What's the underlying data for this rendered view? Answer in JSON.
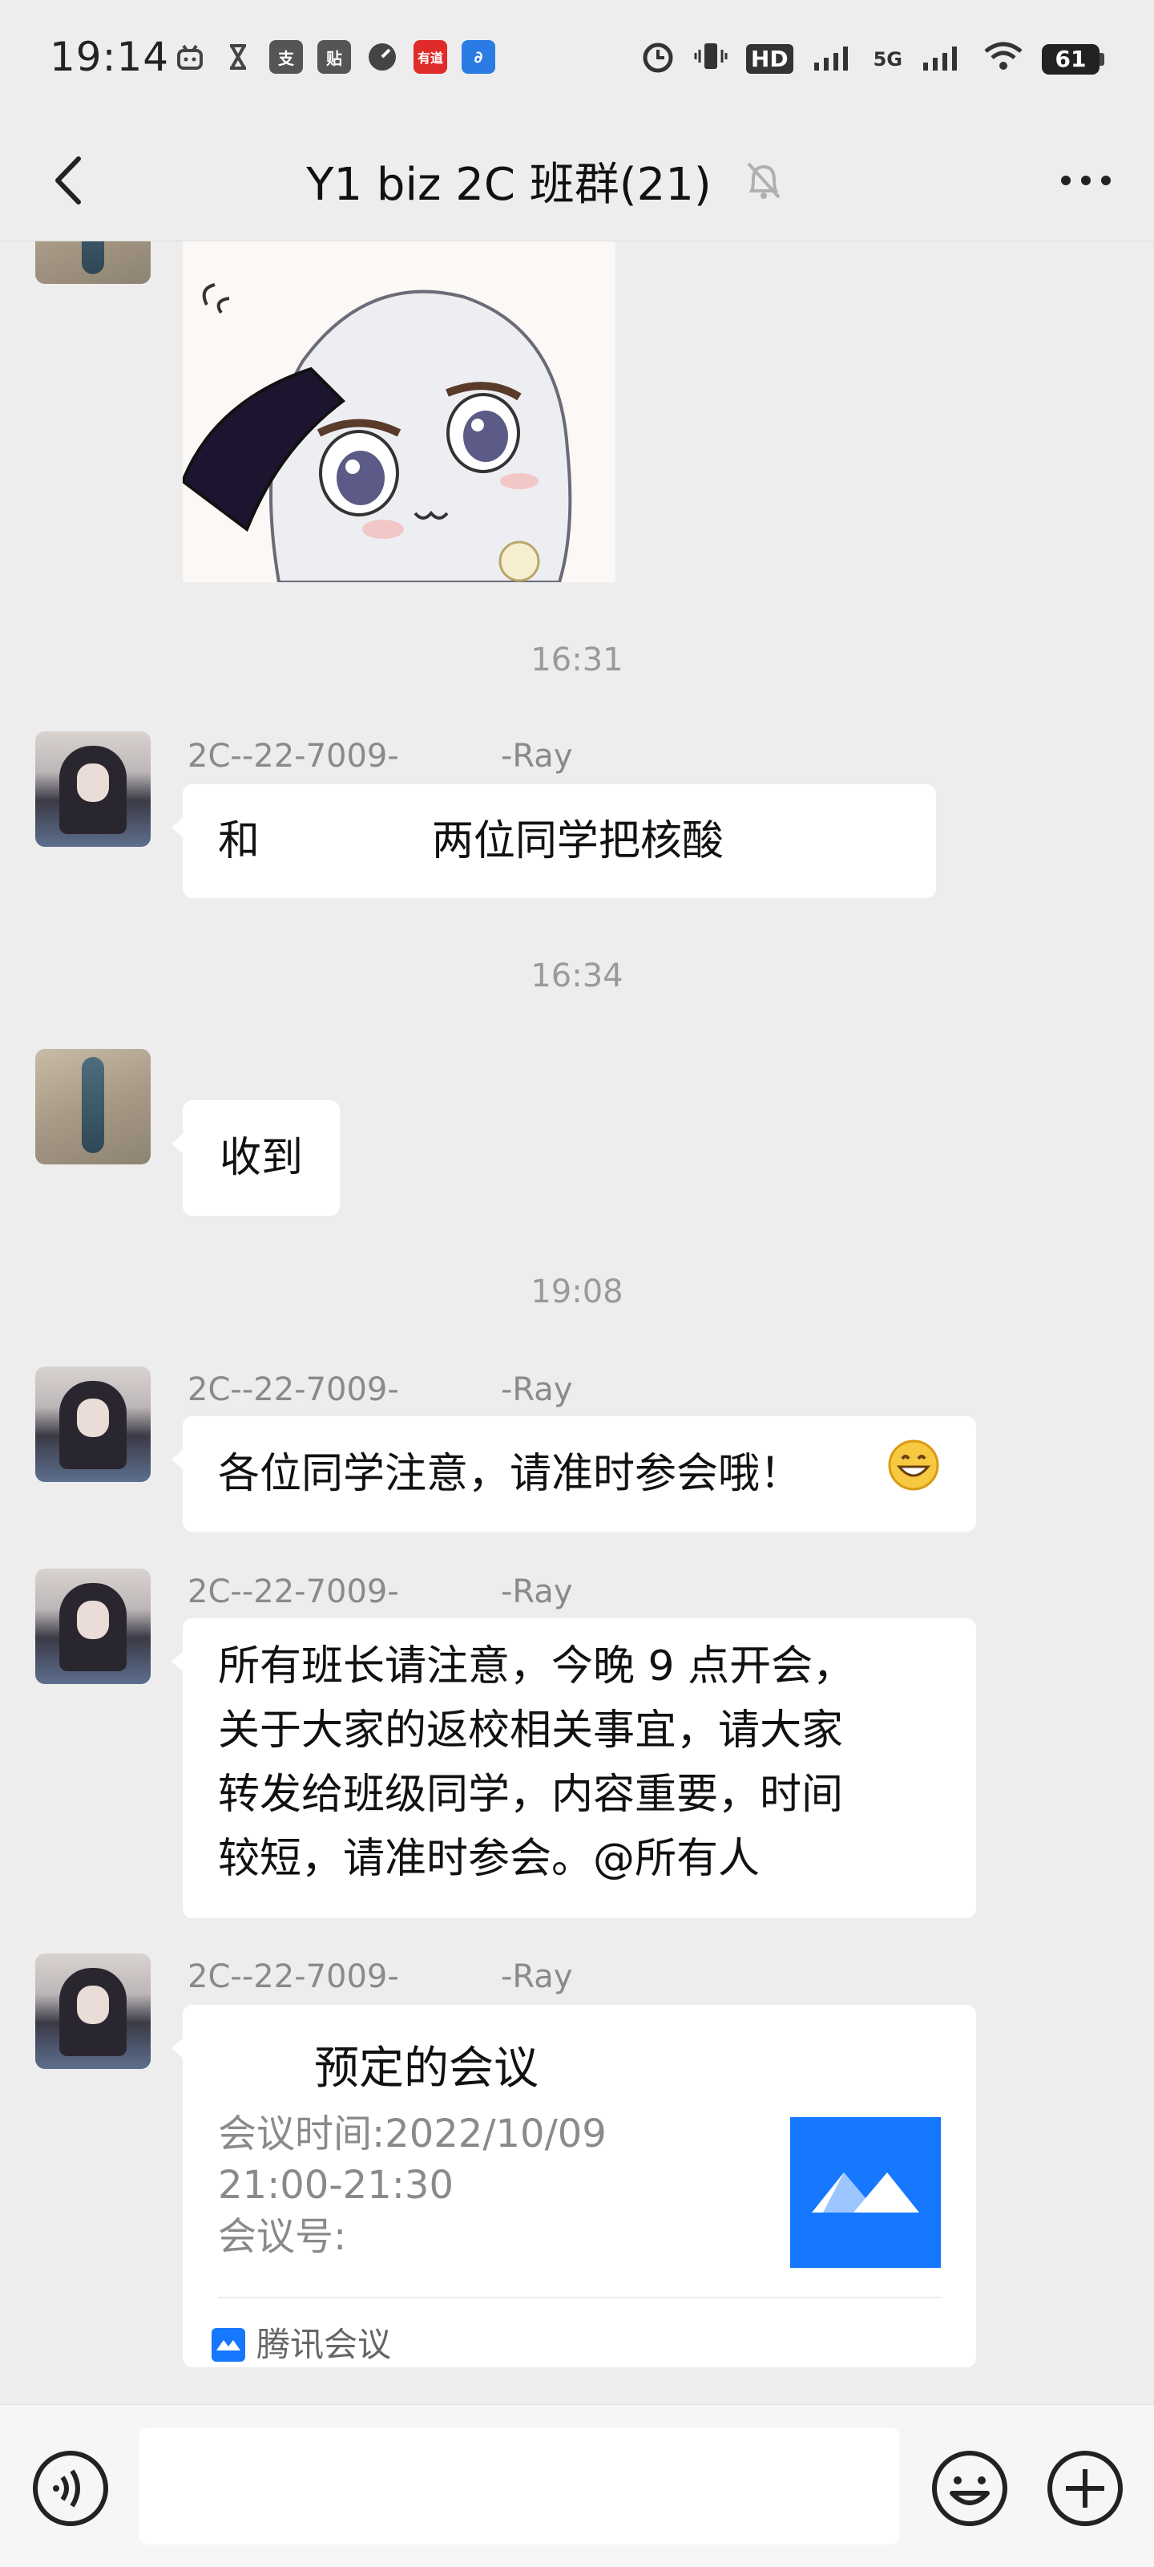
{
  "status_bar": {
    "time": "19:14",
    "network": "5G",
    "hd": "HD",
    "battery": "61"
  },
  "header": {
    "title": "Y1 biz 2C 班群(21)"
  },
  "messages": [
    {
      "type": "timestamp",
      "text": "16:31"
    },
    {
      "sender": "2C--22-7009-          -Ray",
      "text": "和             两位同学把核酸"
    },
    {
      "type": "timestamp",
      "text": "16:34"
    },
    {
      "text": "收到"
    },
    {
      "type": "timestamp",
      "text": "19:08"
    },
    {
      "sender": "2C--22-7009-          -Ray",
      "text": "各位同学注意，请准时参会哦！",
      "emoji": "😄"
    },
    {
      "sender": "2C--22-7009-          -Ray",
      "lines": [
        "所有班长请注意，今晚 9 点开会，",
        "关于大家的返校相关事宜，请大家",
        "转发给班级同学，内容重要，时间",
        "较短，请准时参会。@所有人"
      ]
    },
    {
      "sender": "2C--22-7009-          -Ray",
      "card": {
        "title": "预定的会议",
        "time": "会议时间:2022/10/09",
        "range": "21:00-21:30",
        "number": "会议号:",
        "app": "腾讯会议"
      }
    }
  ],
  "input": {
    "placeholder": ""
  }
}
